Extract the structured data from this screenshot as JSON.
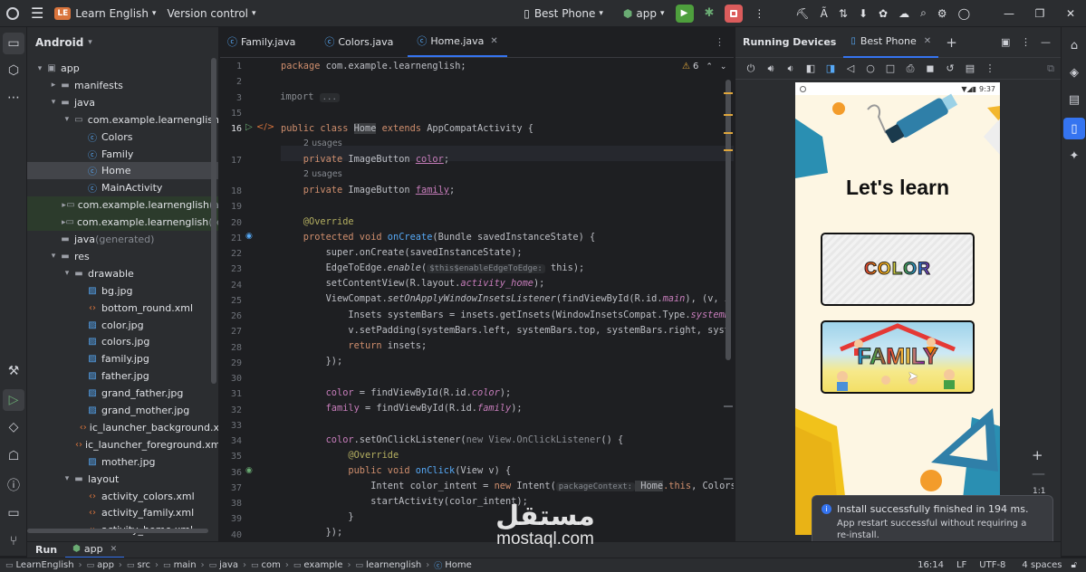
{
  "topbar": {
    "project_badge": "LE",
    "project_name": "Learn English",
    "vcs": "Version control",
    "device": "Best Phone",
    "run_config": "app"
  },
  "project_panel": {
    "title": "Android",
    "tree": [
      {
        "label": "app",
        "level": 0,
        "arrow": "▾",
        "icon": "module-icon"
      },
      {
        "label": "manifests",
        "level": 1,
        "arrow": "▸",
        "icon": "folder-icon"
      },
      {
        "label": "java",
        "level": 1,
        "arrow": "▾",
        "icon": "folder-icon"
      },
      {
        "label": "com.example.learnenglish",
        "level": 2,
        "arrow": "▾",
        "icon": "package-icon"
      },
      {
        "label": "Colors",
        "level": 3,
        "arrow": "",
        "icon": "class-icon"
      },
      {
        "label": "Family",
        "level": 3,
        "arrow": "",
        "icon": "class-icon"
      },
      {
        "label": "Home",
        "level": 3,
        "arrow": "",
        "icon": "class-icon",
        "selected": true
      },
      {
        "label": "MainActivity",
        "level": 3,
        "arrow": "",
        "icon": "class-icon"
      },
      {
        "label": "com.example.learnenglish",
        "suffix": "(a",
        "level": 2,
        "arrow": "▸",
        "icon": "package-icon",
        "green": true
      },
      {
        "label": "com.example.learnenglish",
        "suffix": "(te",
        "level": 2,
        "arrow": "▸",
        "icon": "package-icon",
        "green": true
      },
      {
        "label": "java",
        "suffix": "(generated)",
        "level": 1,
        "arrow": "",
        "icon": "folder-icon"
      },
      {
        "label": "res",
        "level": 1,
        "arrow": "▾",
        "icon": "folder-icon"
      },
      {
        "label": "drawable",
        "level": 2,
        "arrow": "▾",
        "icon": "folder-icon"
      },
      {
        "label": "bg.jpg",
        "level": 3,
        "arrow": "",
        "icon": "image-icon"
      },
      {
        "label": "bottom_round.xml",
        "level": 3,
        "arrow": "",
        "icon": "xml-icon"
      },
      {
        "label": "color.jpg",
        "level": 3,
        "arrow": "",
        "icon": "image-icon"
      },
      {
        "label": "colors.jpg",
        "level": 3,
        "arrow": "",
        "icon": "image-icon"
      },
      {
        "label": "family.jpg",
        "level": 3,
        "arrow": "",
        "icon": "image-icon"
      },
      {
        "label": "father.jpg",
        "level": 3,
        "arrow": "",
        "icon": "image-icon"
      },
      {
        "label": "grand_father.jpg",
        "level": 3,
        "arrow": "",
        "icon": "image-icon"
      },
      {
        "label": "grand_mother.jpg",
        "level": 3,
        "arrow": "",
        "icon": "image-icon"
      },
      {
        "label": "ic_launcher_background.x",
        "level": 3,
        "arrow": "",
        "icon": "xml-icon"
      },
      {
        "label": "ic_launcher_foreground.xm",
        "level": 3,
        "arrow": "",
        "icon": "xml-icon"
      },
      {
        "label": "mother.jpg",
        "level": 3,
        "arrow": "",
        "icon": "image-icon"
      },
      {
        "label": "layout",
        "level": 2,
        "arrow": "▾",
        "icon": "folder-icon"
      },
      {
        "label": "activity_colors.xml",
        "level": 3,
        "arrow": "",
        "icon": "xml-icon"
      },
      {
        "label": "activity_family.xml",
        "level": 3,
        "arrow": "",
        "icon": "xml-icon"
      },
      {
        "label": "activity_home.xml",
        "level": 3,
        "arrow": "",
        "icon": "xml-icon"
      }
    ]
  },
  "editor": {
    "tabs": [
      {
        "label": "Family.java",
        "active": false
      },
      {
        "label": "Colors.java",
        "active": false
      },
      {
        "label": "Home.java",
        "active": true
      }
    ],
    "warnings": "6",
    "line_numbers": [
      "1",
      "2",
      "3",
      "15",
      "16",
      "",
      "17",
      "",
      "18",
      "19",
      "20",
      "21",
      "22",
      "23",
      "24",
      "25",
      "26",
      "27",
      "28",
      "29",
      "30",
      "31",
      "32",
      "33",
      "34",
      "35",
      "36",
      "37",
      "38",
      "39",
      "40"
    ],
    "code": {
      "l1a": "package",
      "l1b": " com.example.learnenglish;",
      "l3a": "import",
      "l3b": "...",
      "l16a": "public class ",
      "l16b": "Home",
      "l16c": " extends ",
      "l16d": "AppCompatActivity {",
      "usage1": "2 usages",
      "l17a": "    private ",
      "l17b": "ImageButton ",
      "l17c": "color",
      "l17d": ";",
      "usage2": "2 usages",
      "l18a": "    private ",
      "l18b": "ImageButton ",
      "l18c": "family",
      "l18d": ";",
      "l20": "    @Override",
      "l21a": "    protected void ",
      "l21b": "onCreate",
      "l21c": "(Bundle savedInstanceState) {",
      "l22": "        super.onCreate(savedInstanceState);",
      "l23a": "        EdgeToEdge.",
      "l23b": "enable",
      "l23c": "(",
      "l23hint": "$this$enableEdgeToEdge:",
      "l23d": " this);",
      "l24a": "        setContentView(R.layout.",
      "l24b": "activity_home",
      "l24c": ");",
      "l25a": "        ViewCompat.",
      "l25b": "setOnApplyWindowInsetsListener",
      "l25c": "(findViewById(R.id.",
      "l25d": "main",
      "l25e": "), (v, i",
      "l26a": "            Insets systemBars = insets.getInsets(WindowInsetsCompat.Type.",
      "l26b": "systemB",
      "l27": "            v.setPadding(systemBars.left, systemBars.top, systemBars.right, syst",
      "l28a": "            return",
      "l28b": " insets;",
      "l29": "        });",
      "l31a": "        ",
      "l31b": "color",
      "l31c": " = findViewById(R.id.",
      "l31d": "color",
      "l31e": ");",
      "l32a": "        ",
      "l32b": "family",
      "l32c": " = findViewById(R.id.",
      "l32d": "family",
      "l32e": ");",
      "l34a": "        ",
      "l34b": "color",
      "l34c": ".setOnClickListener(",
      "l34d": "new",
      "l34e": " View.OnClickListener",
      "l34f": "() {",
      "l35": "            @Override",
      "l36a": "            public void ",
      "l36b": "onClick",
      "l36c": "(View v) {",
      "l37a": "                Intent color_intent = ",
      "l37b": "new",
      "l37c": " Intent(",
      "l37hint": "packageContext:",
      "l37d": " Home",
      "l37e": ".this",
      "l37f": ", Colors",
      "l38": "                startActivity(color_intent);",
      "l39": "            }",
      "l40": "        });"
    }
  },
  "running_devices": {
    "title": "Running Devices",
    "tab": "Best Phone",
    "phone": {
      "time": "9:37",
      "heading": "Let's learn",
      "btn_color": "COLOR",
      "btn_family": "FAMILY"
    },
    "zoom_label": "1:1",
    "toast_title": "Install successfully finished in 194 ms.",
    "toast_body": "App restart successful without requiring a re-install."
  },
  "bottom": {
    "run_tab": "Run",
    "app_tab": "app"
  },
  "statusbar": {
    "breadcrumb": [
      "LearnEnglish",
      "app",
      "src",
      "main",
      "java",
      "com",
      "example",
      "learnenglish",
      "Home"
    ],
    "position": "16:14",
    "line_sep": "LF",
    "encoding": "UTF-8",
    "indent": "4 spaces"
  },
  "watermark": {
    "arabic": "مستقل",
    "latin": "mostaql.com"
  },
  "colors": {
    "accent": "#3574f0",
    "run_green": "#4e9f3d",
    "stop_red": "#db5c5c"
  }
}
